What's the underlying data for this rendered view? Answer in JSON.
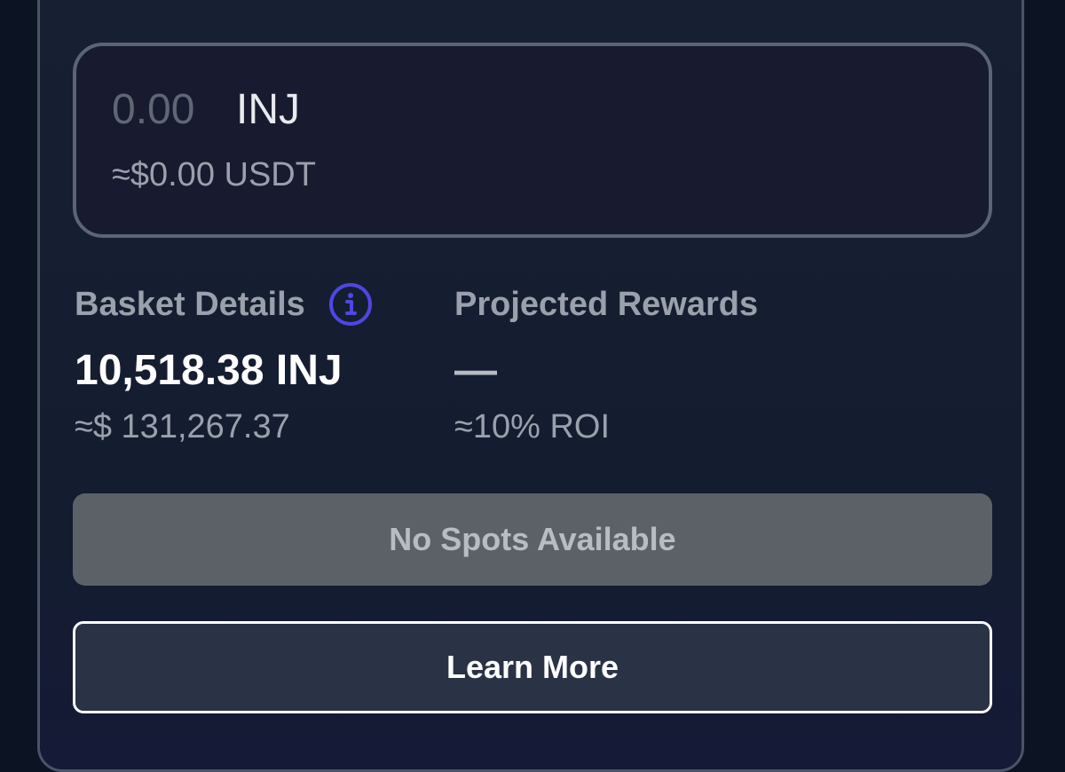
{
  "amount": {
    "value_placeholder": "0.00",
    "token": "INJ",
    "usd_estimate": "≈$0.00 USDT"
  },
  "basket": {
    "label": "Basket Details",
    "info_icon": "info-circle-icon",
    "value": "10,518.38 INJ",
    "usd_value": "≈$ 131,267.37"
  },
  "rewards": {
    "label": "Projected Rewards",
    "value": "—",
    "roi": "≈10% ROI"
  },
  "buttons": {
    "no_spots": "No Spots Available",
    "learn_more": "Learn More"
  },
  "colors": {
    "accent": "#4f46e5",
    "background": "#0c1424",
    "card": "#172033",
    "disabled_button": "#5c6168"
  }
}
